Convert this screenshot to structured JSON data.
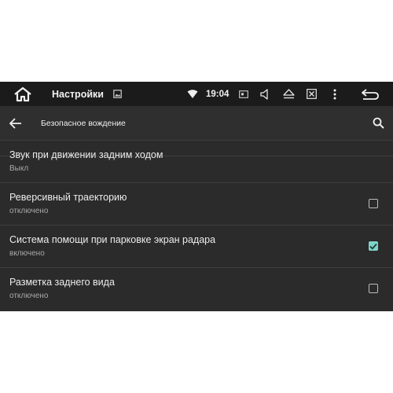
{
  "status_bar": {
    "app_title": "Настройки",
    "time": "19:04",
    "icons": [
      "home-icon",
      "image-icon",
      "wifi-icon",
      "screen-icon",
      "volume-icon",
      "eject-icon",
      "close-box-icon",
      "more-vert-icon",
      "back-icon"
    ]
  },
  "action_bar": {
    "title": "Безопасное вождение",
    "back_icon": "arrow-back-icon",
    "search_icon": "search-icon"
  },
  "settings": [
    {
      "title": "Звук при движении задним ходом",
      "summary": "Выкл",
      "checkbox": null
    },
    {
      "title": "Реверсивный траекторию",
      "summary": "отключено",
      "checkbox": false
    },
    {
      "title": "Система помощи при парковке экран радара",
      "summary": "включено",
      "checkbox": true
    },
    {
      "title": "Разметка заднего вида",
      "summary": "отключено",
      "checkbox": false
    }
  ],
  "colors": {
    "status_bar_bg": "#1b1b1b",
    "screen_bg": "#2b2b2b",
    "accent": "#7fd3c9"
  }
}
